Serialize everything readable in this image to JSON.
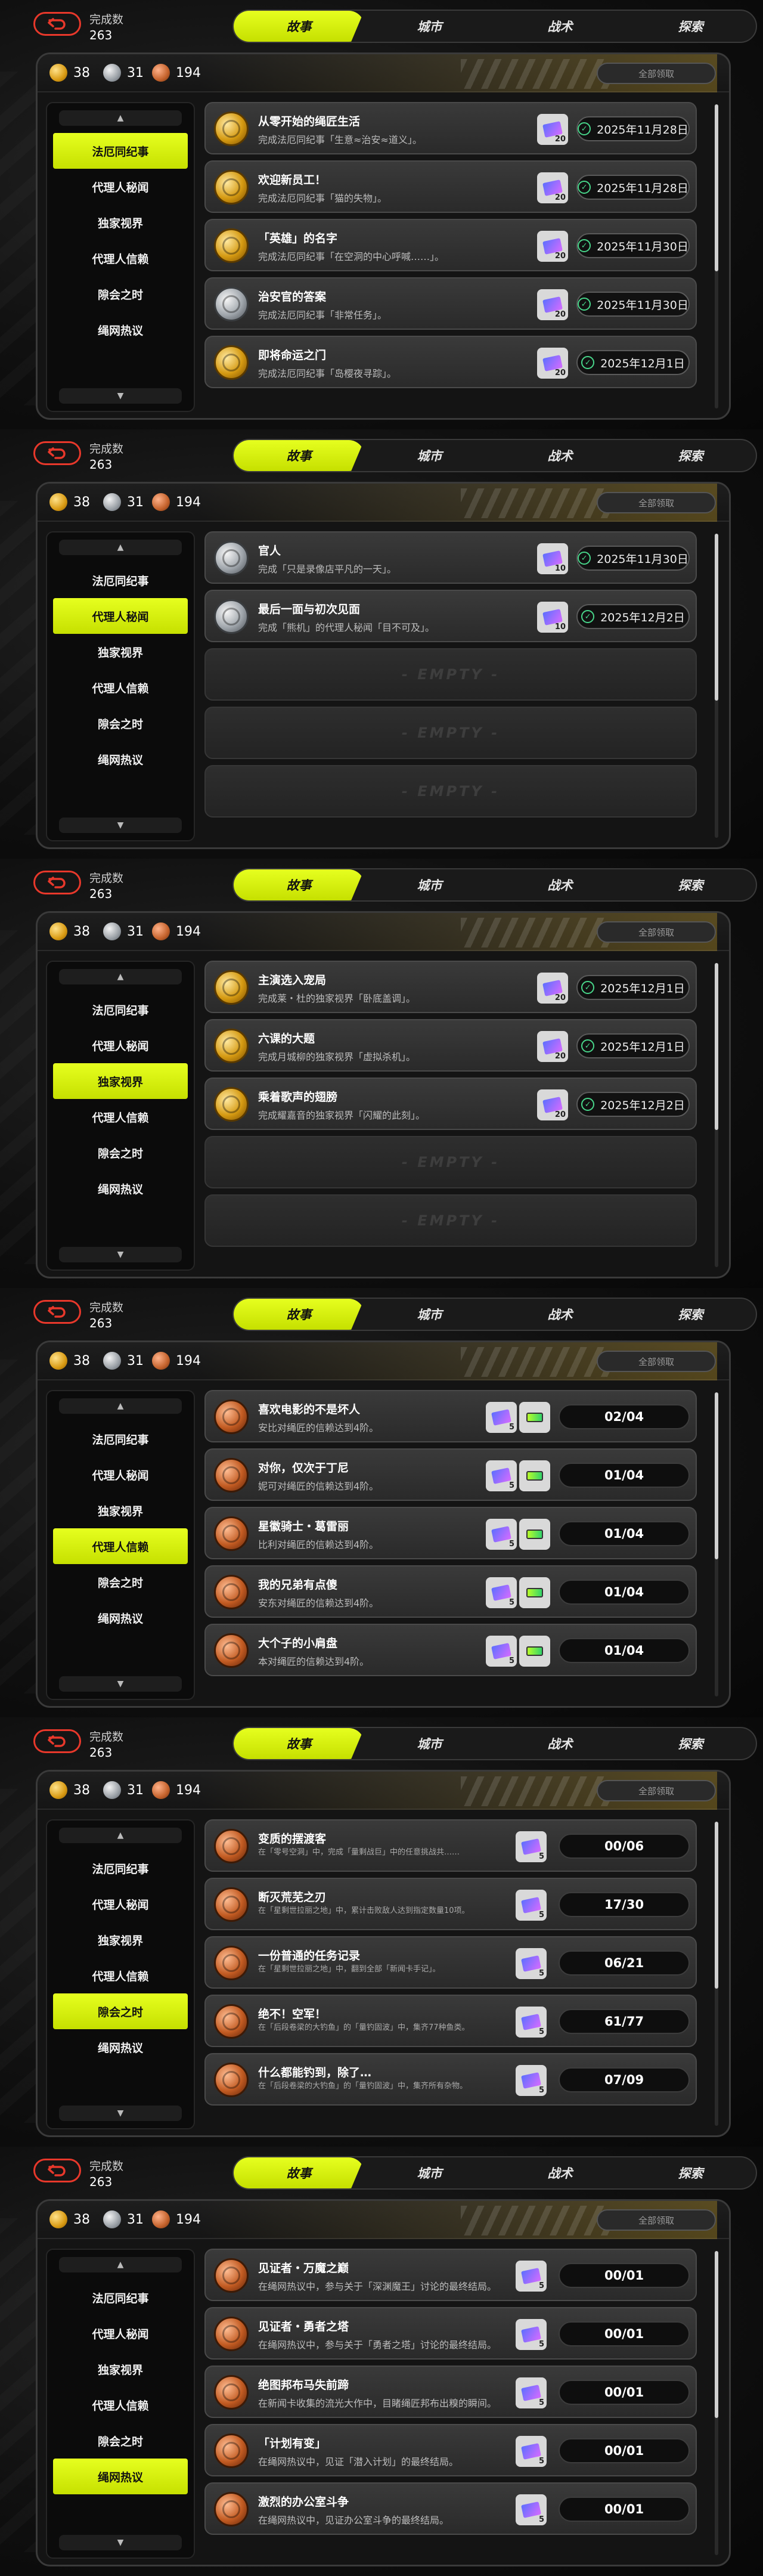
{
  "header": {
    "done_label": "完成数",
    "done_count": "263",
    "tabs": [
      "故事",
      "城市",
      "战术",
      "探索"
    ]
  },
  "currencies": {
    "gold": "38",
    "silver": "31",
    "bronze": "194"
  },
  "claim_all_label": "全部领取",
  "sidebar_items": [
    "法厄同纪事",
    "代理人秘闻",
    "独家视界",
    "代理人信赖",
    "隙会之时",
    "绳网热议"
  ],
  "empty_text": "- EMPTY -",
  "screens": [
    {
      "active_tab": 0,
      "active_side": 0,
      "rows": [
        {
          "medal": "gold",
          "title": "从零开始的绳匠生活",
          "desc": "完成法厄同纪事「生意≈治安≈道义」。",
          "reward_qty": "20",
          "date": "2025年11月28日"
        },
        {
          "medal": "gold",
          "title": "欢迎新员工！",
          "desc": "完成法厄同纪事「猫的失物」。",
          "reward_qty": "20",
          "date": "2025年11月28日"
        },
        {
          "medal": "gold",
          "title": "「英雄」的名字",
          "desc": "完成法厄同纪事「在空洞的中心呼喊……」。",
          "reward_qty": "20",
          "date": "2025年11月30日"
        },
        {
          "medal": "silver",
          "title": "治安官的答案",
          "desc": "完成法厄同纪事「非常任务」。",
          "reward_qty": "20",
          "date": "2025年11月30日"
        },
        {
          "medal": "gold",
          "title": "即将命运之门",
          "desc": "完成法厄同纪事「岛樱夜寻踪」。",
          "reward_qty": "20",
          "date": "2025年12月1日"
        }
      ]
    },
    {
      "active_tab": 0,
      "active_side": 1,
      "rows": [
        {
          "medal": "silver",
          "title": "官人",
          "desc": "完成「只是录像店平凡的一天」。",
          "reward_qty": "10",
          "date": "2025年11月30日"
        },
        {
          "medal": "silver",
          "title": "最后一面与初次见面",
          "desc": "完成「熊机」的代理人秘闻「目不可及」。",
          "reward_qty": "10",
          "date": "2025年12月2日"
        },
        {
          "empty": true
        },
        {
          "empty": true
        },
        {
          "empty": true
        }
      ]
    },
    {
      "active_tab": 0,
      "active_side": 2,
      "rows": [
        {
          "medal": "gold",
          "title": "主演选入宠局",
          "desc": "完成莱・杜的独家视界「卧底盖调」。",
          "reward_qty": "20",
          "date": "2025年12月1日"
        },
        {
          "medal": "gold",
          "title": "六课的大题",
          "desc": "完成月城柳的独家视界「虚拟杀机」。",
          "reward_qty": "20",
          "date": "2025年12月1日"
        },
        {
          "medal": "gold",
          "title": "乘着歌声的翅膀",
          "desc": "完成耀嘉音的独家视界「闪耀的此刻」。",
          "reward_qty": "20",
          "date": "2025年12月2日"
        },
        {
          "empty": true
        },
        {
          "empty": true
        }
      ]
    },
    {
      "active_tab": 0,
      "active_side": 3,
      "rows": [
        {
          "medal": "bronze",
          "title": "喜欢电影的不是坏人",
          "desc": "安比对绳匠的信赖达到4阶。",
          "reward_qty": "5",
          "progress": "02/04"
        },
        {
          "medal": "bronze",
          "title": "对你，仅次于丁尼",
          "desc": "妮可对绳匠的信赖达到4阶。",
          "reward_qty": "5",
          "progress": "01/04"
        },
        {
          "medal": "bronze",
          "title": "星徽骑士・葛雷丽",
          "desc": "比利对绳匠的信赖达到4阶。",
          "reward_qty": "5",
          "progress": "01/04"
        },
        {
          "medal": "bronze",
          "title": "我的兄弟有点傻",
          "desc": "安东对绳匠的信赖达到4阶。",
          "reward_qty": "5",
          "progress": "01/04"
        },
        {
          "medal": "bronze",
          "title": "大个子的小肩盘",
          "desc": "本对绳匠的信赖达到4阶。",
          "reward_qty": "5",
          "progress": "01/04"
        }
      ]
    },
    {
      "active_tab": 0,
      "active_side": 4,
      "rows": [
        {
          "medal": "bronze",
          "title": "变质的摆渡客",
          "desc": "在「零号空洞」中，完成「量剩战巨」中的任意挑战共……",
          "reward_qty": "5",
          "progress": "00/06"
        },
        {
          "medal": "bronze",
          "title": "断灭荒芜之刃",
          "desc": "在「星剩世拉丽之地」中，累计击败敌人达到指定数量10项。",
          "reward_qty": "5",
          "progress": "17/30"
        },
        {
          "medal": "bronze",
          "title": "一份普通的任务记录",
          "desc": "在「星剩世拉丽之地」中，翻到全部「新闻卡手记」。",
          "reward_qty": "5",
          "progress": "06/21"
        },
        {
          "medal": "bronze",
          "title": "绝不！空军！",
          "desc": "在「后段卷梁的大钓鱼」的「量钓固波」中，集齐77种鱼类。",
          "reward_qty": "5",
          "progress": "61/77"
        },
        {
          "medal": "bronze",
          "title": "什么都能钓到，除了…",
          "desc": "在「后段卷梁的大钓鱼」的「量钓固波」中，集齐所有杂物。",
          "reward_qty": "5",
          "progress": "07/09"
        }
      ]
    },
    {
      "active_tab": 0,
      "active_side": 5,
      "rows": [
        {
          "medal": "bronze",
          "title": "见证者・万魔之巅",
          "desc": "在绳网热议中，参与关于「深渊魔王」讨论的最终结局。",
          "reward_qty": "5",
          "progress": "00/01"
        },
        {
          "medal": "bronze",
          "title": "见证者・勇者之塔",
          "desc": "在绳网热议中，参与关于「勇者之塔」讨论的最终结局。",
          "reward_qty": "5",
          "progress": "00/01"
        },
        {
          "medal": "bronze",
          "title": "绝图邦布马失前蹄",
          "desc": "在新闻卡收集的流光大作中，目睹绳匠邦布出糗的瞬间。",
          "reward_qty": "5",
          "progress": "00/01"
        },
        {
          "medal": "bronze",
          "title": "「计划有变」",
          "desc": "在绳网热议中，见证「潜入计划」的最终结局。",
          "reward_qty": "5",
          "progress": "00/01"
        },
        {
          "medal": "bronze",
          "title": "激烈的办公室斗争",
          "desc": "在绳网热议中，见证办公室斗争的最终结局。",
          "reward_qty": "5",
          "progress": "00/01"
        }
      ]
    }
  ]
}
